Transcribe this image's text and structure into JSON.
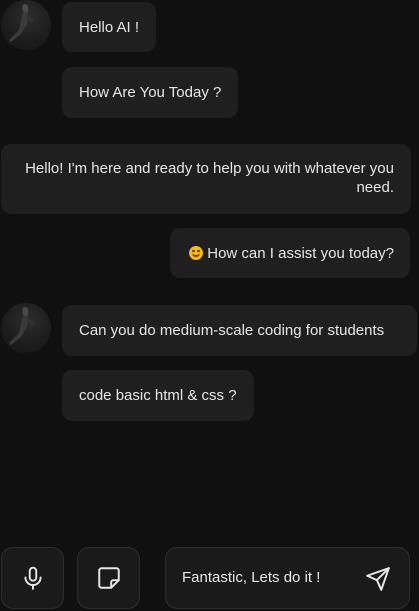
{
  "messages": [
    {
      "sender": "user",
      "text": "Hello AI !"
    },
    {
      "sender": "user",
      "text": "How Are You Today ?"
    },
    {
      "sender": "assistant",
      "text": "Hello! I'm here and ready to help you with whatever you need."
    },
    {
      "sender": "assistant",
      "emoji": "smiling-face-icon",
      "text": "How can I assist you today?"
    },
    {
      "sender": "user",
      "text": "Can you do medium-scale coding for students"
    },
    {
      "sender": "user",
      "text": "code  basic html & css ?"
    }
  ],
  "composer": {
    "value": "Fantastic,  Lets do it !"
  },
  "icons": {
    "mic": "microphone-icon",
    "attach": "sticky-note-icon",
    "send": "send-icon"
  },
  "colors": {
    "background": "#101010",
    "bubble": "#1f1f1f",
    "text": "#e6e6e6",
    "emoji": "#f5b820"
  }
}
